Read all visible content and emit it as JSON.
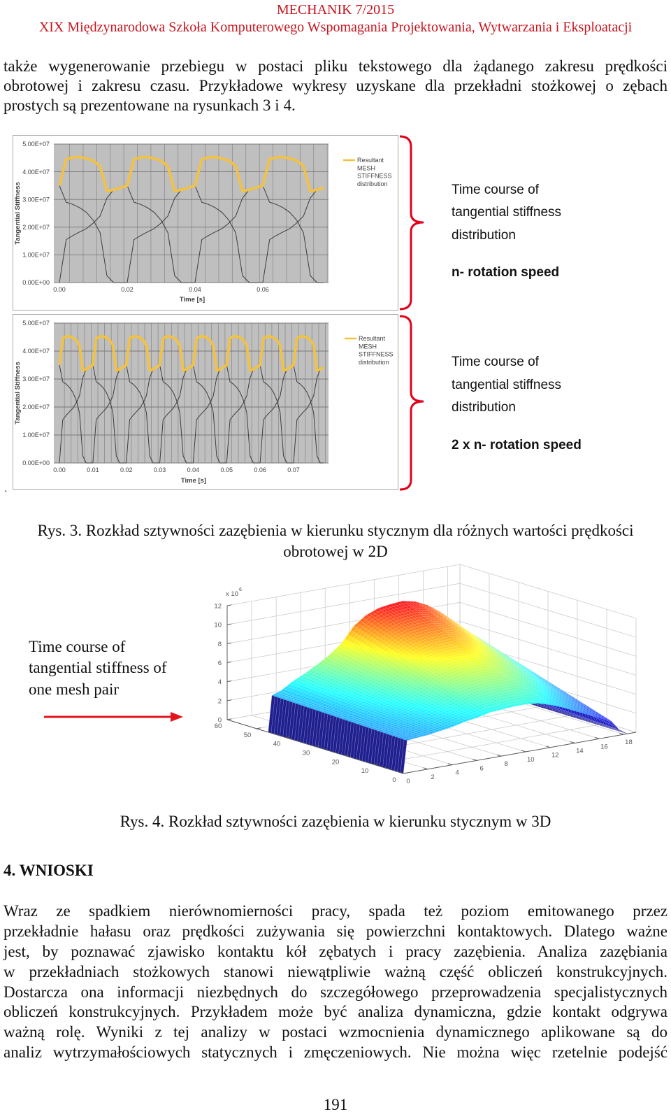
{
  "header": {
    "journal": "MECHANIK 7/2015",
    "conference": "XIX Międzynarodowa Szkoła Komputerowego Wspomagania Projektowania, Wytwarzania i Eksploatacji"
  },
  "intro": {
    "lines": [
      "także wygenerowanie przebiegu w postaci pliku tekstowego dla żądanego zakresu prędkości",
      "obrotowej i zakresu czasu. Przykładowe wykresy uzyskane dla przekładni stożkowej o zębach",
      "prostych są prezentowane na rysunkach 3 i 4."
    ]
  },
  "figure3": {
    "annotations": [
      {
        "lines": [
          "Time course of",
          "tangential stiffness",
          "distribution"
        ],
        "emphasis": "n- rotation speed"
      },
      {
        "lines": [
          "Time course of",
          "tangential stiffness",
          "distribution"
        ],
        "emphasis": "2 x n- rotation speed"
      }
    ],
    "stray_mark": "`",
    "caption_lines": [
      "Rys. 3. Rozkład sztywności zazębienia w kierunku stycznym dla różnych wartości prędkości",
      "obrotowej w 2D"
    ]
  },
  "figure4": {
    "annotation_lines": [
      "Time course of",
      "tangential stiffness of",
      "one mesh pair"
    ],
    "caption": "Rys. 4. Rozkład sztywności zazębienia w kierunku stycznym w 3D"
  },
  "section": {
    "heading": "4. WNIOSKI",
    "lines": [
      "Wraz ze spadkiem nierównomierności pracy, spada też poziom emitowanego przez",
      "przekładnie hałasu oraz prędkości zużywania się powierzchni kontaktowych. Dlatego ważne",
      "jest, by poznawać zjawisko kontaktu kół zębatych i pracy zazębienia. Analiza zazębiania",
      "w przekładniach stożkowych stanowi niewątpliwie ważną część obliczeń konstrukcyjnych.",
      "Dostarcza ona informacji niezbędnych do szczegółowego przeprowadzenia specjalistycznych",
      "obliczeń konstrukcyjnych. Przykładem może być analiza dynamiczna, gdzie kontakt odgrywa",
      "ważną rolę. Wyniki z tej analizy w postaci wzmocnienia dynamicznego aplikowane są do",
      "analiz wytrzymałościowych statycznych i zmęczeniowych. Nie można więc rzetelnie podejść"
    ]
  },
  "page_number": "191",
  "colors": {
    "header_red": "#c8141e",
    "bracket_red": "#e2001a",
    "arrow_red": "#e3141d",
    "plot_background": "#bfbfbf",
    "frame": "#a8a8a8"
  },
  "chart_data": [
    {
      "type": "line",
      "title": "",
      "xlabel": "Time [s]",
      "ylabel": "Tangential Stiffness",
      "xlim": [
        0,
        0.08
      ],
      "ylim": [
        0,
        50000000.0
      ],
      "xticks": [
        0,
        0.02,
        0.04,
        0.06
      ],
      "xticklabels": [
        "0.00",
        "0.02",
        "0.04",
        "0.06"
      ],
      "yticks": [
        0,
        10000000.0,
        20000000.0,
        30000000.0,
        40000000.0,
        50000000.0
      ],
      "yticklabels": [
        "0.00E+00",
        "1.00E+07",
        "2.00E+07",
        "3.00E+07",
        "4.00E+07",
        "5.00E+07"
      ],
      "grid": true,
      "legend": {
        "position": "right",
        "entry_lines": [
          "Resultant",
          "MESH",
          "STIFFNESS",
          "distribution"
        ]
      },
      "series": [
        {
          "name": "Resultant MESH STIFFNESS distribution",
          "color": "#f3c240",
          "x_start": 0,
          "x_step": 0.002,
          "values": [
            35000000.0,
            44500000.0,
            45200000.0,
            45300000.0,
            44800000.0,
            44000000.0,
            42000000.0,
            33000000.0,
            33500000.0,
            34200000.0,
            35000000.0,
            44500000.0,
            45200000.0,
            45300000.0,
            44800000.0,
            44000000.0,
            42000000.0,
            33000000.0,
            33500000.0,
            34200000.0,
            35000000.0,
            44500000.0,
            45200000.0,
            45300000.0,
            44800000.0,
            44000000.0,
            42000000.0,
            33000000.0,
            33500000.0,
            34200000.0,
            35000000.0,
            44500000.0,
            45200000.0,
            45300000.0,
            44800000.0,
            44000000.0,
            42000000.0,
            33000000.0,
            33500000.0,
            34200000.0
          ]
        },
        {
          "name": "",
          "color": "#3c3c3c",
          "x_start": 0,
          "x_step": 0.002,
          "values": [
            35000000.0,
            29000000.0,
            28200000.0,
            27000000.0,
            25300000.0,
            22500000.0,
            18000000.0,
            2500000.0,
            0,
            0,
            0
          ]
        },
        {
          "name": "",
          "color": "#3c3c3c",
          "x_start": 0,
          "x_step": 0.002,
          "values": [
            0,
            15500000.0,
            17000000.0,
            18300000.0,
            19500000.0,
            21500000.0,
            24000000.0,
            30500000.0,
            33500000.0,
            34200000.0,
            35000000.0,
            29000000.0,
            28200000.0,
            27000000.0,
            25300000.0,
            22500000.0,
            18000000.0,
            2500000.0,
            0,
            0,
            0
          ]
        },
        {
          "name": "",
          "color": "#3c3c3c",
          "x_start": 0.02,
          "x_step": 0.002,
          "values": [
            0,
            15500000.0,
            17000000.0,
            18300000.0,
            19500000.0,
            21500000.0,
            24000000.0,
            30500000.0,
            33500000.0,
            34200000.0,
            35000000.0,
            29000000.0,
            28200000.0,
            27000000.0,
            25300000.0,
            22500000.0,
            18000000.0,
            2500000.0,
            0,
            0,
            0
          ]
        },
        {
          "name": "",
          "color": "#3c3c3c",
          "x_start": 0.04,
          "x_step": 0.002,
          "values": [
            0,
            15500000.0,
            17000000.0,
            18300000.0,
            19500000.0,
            21500000.0,
            24000000.0,
            30500000.0,
            33500000.0,
            34200000.0,
            35000000.0,
            29000000.0,
            28200000.0,
            27000000.0,
            25300000.0,
            22500000.0,
            18000000.0,
            2500000.0,
            0,
            0
          ]
        },
        {
          "name": "",
          "color": "#3c3c3c",
          "x_start": 0.06,
          "x_step": 0.002,
          "values": [
            0,
            15500000.0,
            17000000.0,
            18300000.0,
            19500000.0,
            21500000.0,
            24000000.0,
            30500000.0,
            33500000.0,
            34200000.0
          ]
        }
      ]
    },
    {
      "type": "line",
      "title": "",
      "xlabel": "Time [s]",
      "ylabel": "Tangential Stiffness",
      "xlim": [
        0,
        0.08
      ],
      "ylim": [
        0,
        50000000.0
      ],
      "xticks": [
        0,
        0.01,
        0.02,
        0.03,
        0.04,
        0.05,
        0.06,
        0.07
      ],
      "xticklabels": [
        "0.00",
        "0.01",
        "0.02",
        "0.03",
        "0.04",
        "0.05",
        "0.06",
        "0.07"
      ],
      "yticks": [
        0,
        10000000.0,
        20000000.0,
        30000000.0,
        40000000.0,
        50000000.0
      ],
      "yticklabels": [
        "0.00E+00",
        "1.00E+07",
        "2.00E+07",
        "3.00E+07",
        "4.00E+07",
        "5.00E+07"
      ],
      "grid": true,
      "legend": {
        "position": "right",
        "entry_lines": [
          "Resultant",
          "MESH",
          "STIFFNESS",
          "distribution"
        ]
      },
      "series": [
        {
          "name": "Resultant MESH STIFFNESS distribution",
          "color": "#f3c240",
          "x_start": 0,
          "x_step": 0.001,
          "values": [
            35000000.0,
            44500000.0,
            45200000.0,
            45300000.0,
            44800000.0,
            44000000.0,
            42000000.0,
            33000000.0,
            33500000.0,
            34200000.0,
            35000000.0,
            44500000.0,
            45200000.0,
            45300000.0,
            44800000.0,
            44000000.0,
            42000000.0,
            33000000.0,
            33500000.0,
            34200000.0,
            35000000.0,
            44500000.0,
            45200000.0,
            45300000.0,
            44800000.0,
            44000000.0,
            42000000.0,
            33000000.0,
            33500000.0,
            34200000.0,
            35000000.0,
            44500000.0,
            45200000.0,
            45300000.0,
            44800000.0,
            44000000.0,
            42000000.0,
            33000000.0,
            33500000.0,
            34200000.0,
            35000000.0,
            44500000.0,
            45200000.0,
            45300000.0,
            44800000.0,
            44000000.0,
            42000000.0,
            33000000.0,
            33500000.0,
            34200000.0,
            35000000.0,
            44500000.0,
            45200000.0,
            45300000.0,
            44800000.0,
            44000000.0,
            42000000.0,
            33000000.0,
            33500000.0,
            34200000.0,
            35000000.0,
            44500000.0,
            45200000.0,
            45300000.0,
            44800000.0,
            44000000.0,
            42000000.0,
            33000000.0,
            33500000.0,
            34200000.0,
            35000000.0,
            44500000.0,
            45200000.0,
            45300000.0,
            44800000.0,
            44000000.0,
            42000000.0,
            33000000.0,
            33500000.0,
            34200000.0
          ]
        },
        {
          "name": "",
          "color": "#3c3c3c",
          "x_start": 0,
          "x_step": 0.001,
          "values": [
            35000000.0,
            29000000.0,
            28200000.0,
            27000000.0,
            25300000.0,
            22500000.0,
            18000000.0,
            2500000.0,
            0,
            0,
            0
          ]
        },
        {
          "name": "",
          "color": "#3c3c3c",
          "x_start": 0,
          "x_step": 0.001,
          "values": [
            0,
            15500000.0,
            17000000.0,
            18300000.0,
            19500000.0,
            21500000.0,
            24000000.0,
            30500000.0,
            33500000.0,
            34200000.0,
            35000000.0,
            29000000.0,
            28200000.0,
            27000000.0,
            25300000.0,
            22500000.0,
            18000000.0,
            2500000.0,
            0,
            0,
            0
          ]
        },
        {
          "name": "",
          "color": "#3c3c3c",
          "x_start": 0.01,
          "x_step": 0.001,
          "values": [
            0,
            15500000.0,
            17000000.0,
            18300000.0,
            19500000.0,
            21500000.0,
            24000000.0,
            30500000.0,
            33500000.0,
            34200000.0,
            35000000.0,
            29000000.0,
            28200000.0,
            27000000.0,
            25300000.0,
            22500000.0,
            18000000.0,
            2500000.0,
            0,
            0,
            0
          ]
        },
        {
          "name": "",
          "color": "#3c3c3c",
          "x_start": 0.02,
          "x_step": 0.001,
          "values": [
            0,
            15500000.0,
            17000000.0,
            18300000.0,
            19500000.0,
            21500000.0,
            24000000.0,
            30500000.0,
            33500000.0,
            34200000.0,
            35000000.0,
            29000000.0,
            28200000.0,
            27000000.0,
            25300000.0,
            22500000.0,
            18000000.0,
            2500000.0,
            0,
            0,
            0
          ]
        },
        {
          "name": "",
          "color": "#3c3c3c",
          "x_start": 0.03,
          "x_step": 0.001,
          "values": [
            0,
            15500000.0,
            17000000.0,
            18300000.0,
            19500000.0,
            21500000.0,
            24000000.0,
            30500000.0,
            33500000.0,
            34200000.0,
            35000000.0,
            29000000.0,
            28200000.0,
            27000000.0,
            25300000.0,
            22500000.0,
            18000000.0,
            2500000.0,
            0,
            0,
            0
          ]
        },
        {
          "name": "",
          "color": "#3c3c3c",
          "x_start": 0.04,
          "x_step": 0.001,
          "values": [
            0,
            15500000.0,
            17000000.0,
            18300000.0,
            19500000.0,
            21500000.0,
            24000000.0,
            30500000.0,
            33500000.0,
            34200000.0,
            35000000.0,
            29000000.0,
            28200000.0,
            27000000.0,
            25300000.0,
            22500000.0,
            18000000.0,
            2500000.0,
            0,
            0,
            0
          ]
        },
        {
          "name": "",
          "color": "#3c3c3c",
          "x_start": 0.05,
          "x_step": 0.001,
          "values": [
            0,
            15500000.0,
            17000000.0,
            18300000.0,
            19500000.0,
            21500000.0,
            24000000.0,
            30500000.0,
            33500000.0,
            34200000.0,
            35000000.0,
            29000000.0,
            28200000.0,
            27000000.0,
            25300000.0,
            22500000.0,
            18000000.0,
            2500000.0,
            0,
            0,
            0
          ]
        },
        {
          "name": "",
          "color": "#3c3c3c",
          "x_start": 0.06,
          "x_step": 0.001,
          "values": [
            0,
            15500000.0,
            17000000.0,
            18300000.0,
            19500000.0,
            21500000.0,
            24000000.0,
            30500000.0,
            33500000.0,
            34200000.0,
            35000000.0,
            29000000.0,
            28200000.0,
            27000000.0,
            25300000.0,
            22500000.0,
            18000000.0,
            2500000.0,
            0,
            0
          ]
        },
        {
          "name": "",
          "color": "#3c3c3c",
          "x_start": 0.07,
          "x_step": 0.001,
          "values": [
            0,
            15500000.0,
            17000000.0,
            18300000.0,
            19500000.0,
            21500000.0,
            24000000.0,
            30500000.0,
            33500000.0,
            34200000.0
          ]
        }
      ]
    },
    {
      "type": "heatmap",
      "render": "3d-mesh",
      "title": "",
      "colormap": "jet",
      "clim": [
        0,
        12.5
      ],
      "xlim": [
        0,
        19
      ],
      "ylim": [
        0,
        60
      ],
      "zlim": [
        0,
        12
      ],
      "xticks": [
        0,
        2,
        4,
        6,
        8,
        10,
        12,
        14,
        16,
        18
      ],
      "xticklabels": [
        "0",
        "2",
        "4",
        "6",
        "8",
        "10",
        "12",
        "14",
        "16",
        "18"
      ],
      "yticks": [
        0,
        10,
        20,
        30,
        40,
        50,
        60
      ],
      "yticklabels": [
        "0",
        "10",
        "20",
        "30",
        "40",
        "50",
        "60"
      ],
      "zticks": [
        0,
        2,
        4,
        6,
        8,
        10,
        12
      ],
      "zticklabels": [
        "0",
        "2",
        "4",
        "6",
        "8",
        "10",
        "12"
      ],
      "z_multiplier": {
        "base": "x 10",
        "exponent": "6"
      },
      "grid": true,
      "surface": {
        "x": [
          0,
          0.3,
          1,
          2,
          3,
          4,
          5,
          6,
          7,
          8,
          9,
          10,
          11,
          12,
          13,
          14,
          15,
          16,
          17,
          17.6,
          18.3
        ],
        "y_range": [
          0,
          46
        ],
        "n_rows": 47,
        "z_front": [
          0,
          3.4,
          3.5,
          3.6,
          3.8,
          4.0,
          4.3,
          4.5,
          4.8,
          4.9,
          5.0,
          5.0,
          4.9,
          4.5,
          4.0,
          3.4,
          2.8,
          2.2,
          1.6,
          0.6,
          0
        ],
        "z_back": [
          0,
          3.8,
          4.1,
          4.9,
          5.5,
          6.2,
          7.0,
          8.0,
          9.6,
          10.5,
          11.0,
          11.2,
          11.3,
          11.0,
          10.4,
          9.5,
          8.4,
          7.2,
          6.2,
          1.2,
          0
        ]
      }
    }
  ]
}
